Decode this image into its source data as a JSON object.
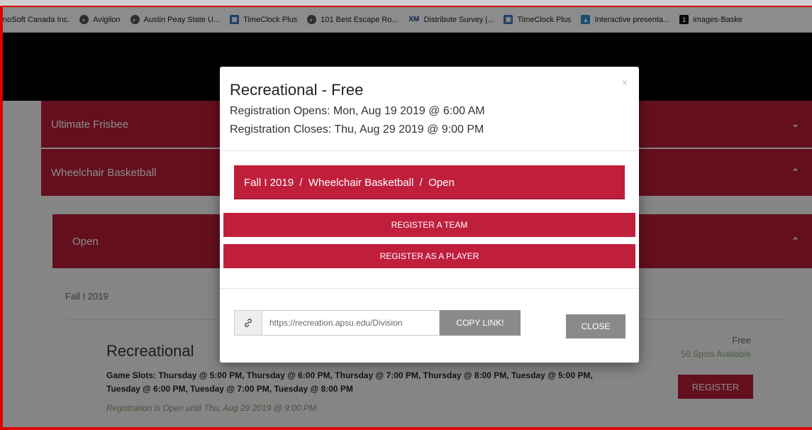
{
  "bookmarks": [
    {
      "label": "noSoft Canada Inc.",
      "icon": "none"
    },
    {
      "label": "Avigilon",
      "icon": "globe-icon"
    },
    {
      "label": "Austin Peay State U...",
      "icon": "globe-icon"
    },
    {
      "label": "TimeClock Plus",
      "icon": "timeclock-icon"
    },
    {
      "label": "101 Best Escape Ro...",
      "icon": "globe-icon"
    },
    {
      "label": "Distribute Survey |...",
      "icon": "xm-icon",
      "icon_text": "XM"
    },
    {
      "label": "TimeClock Plus",
      "icon": "timeclock-icon"
    },
    {
      "label": "Interactive presenta...",
      "icon": "presentation-icon"
    },
    {
      "label": "images-Baske",
      "icon": "one-icon",
      "icon_text": "1"
    }
  ],
  "accordions": {
    "ultimate": {
      "label": "Ultimate Frisbee",
      "chevron": "⌄"
    },
    "wheelchair": {
      "label": "Wheelchair Basketball",
      "chevron": "⌃"
    },
    "open": {
      "label": "Open",
      "chevron": "⌃"
    }
  },
  "division": {
    "season": "Fall I 2019",
    "title": "Recreational",
    "game_slots": "Game Slots: Thursday @ 5:00 PM, Thursday @ 6:00 PM, Thursday @ 7:00 PM, Thursday @ 8:00 PM, Tuesday @ 5:00 PM, Tuesday @ 6:00 PM, Tuesday @ 7:00 PM, Tuesday @ 8:00 PM",
    "registration_open": "Registration is Open until Thu, Aug 29 2019 @ 9:00 PM",
    "price": "Free",
    "spots": "50 Spots Available",
    "register_label": "REGISTER"
  },
  "modal": {
    "close_x": "×",
    "title": "Recreational - Free",
    "opens": "Registration Opens: Mon, Aug 19 2019 @ 6:00 AM",
    "closes": "Registration Closes: Thu, Aug 29 2019 @ 9:00 PM",
    "breadcrumb": "Fall I 2019  /  Wheelchair Basketball  /  Open",
    "register_team": "REGISTER A TEAM",
    "register_player": "REGISTER AS A PLAYER",
    "link_value": "https://recreation.apsu.edu/Division",
    "copy_label": "COPY LINK!",
    "close_label": "CLOSE"
  },
  "colors": {
    "accent": "#c01f3c",
    "frame": "#d90000",
    "header": "#000000"
  }
}
